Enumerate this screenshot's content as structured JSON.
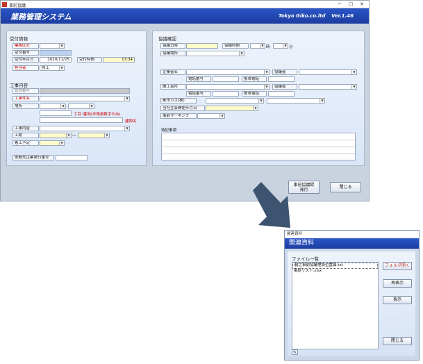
{
  "main": {
    "titlebar": {
      "title": "事前協議",
      "min": "─",
      "max": "□",
      "close": "✕"
    },
    "banner": {
      "system_title": "業務管理システム",
      "company": "Tokyo Giko.co.ltd",
      "version": "Ver.1.46"
    },
    "left": {
      "reception": {
        "section": "受付情報",
        "business_type_label": "業務区分",
        "receipt_no_label": "受付番号",
        "receipt_date_label": "受付年月日",
        "receipt_date_value": "2020/11/25",
        "receipt_time_label": "受付時間",
        "receipt_time_value": "13:34",
        "person_label": "担当者",
        "person_value": "技工"
      },
      "work": {
        "section": "工事内容",
        "management_no_label": "管理番号",
        "work_name_label": "工事件名",
        "location_label": "場所",
        "address_hint": "丁目･番地(半角英数字のみ)",
        "building_label": "建物名",
        "work_content_label": "工事内容",
        "period_label": "工期",
        "tilde": "〜",
        "plan_label": "着工予定"
      },
      "request_no_label": "依頼先企業発行番号"
    },
    "right": {
      "section": "協議確認",
      "meeting_date_label": "協議日時",
      "meeting_time_label": "協議時間",
      "hour_unit": "時",
      "minute_unit": "分",
      "meeting_place_label": "協議場所",
      "company_name_label": "企業者名",
      "phone_label": "電話番号",
      "mobile_label": "携帯電話",
      "negotiator_label": "協議者",
      "contractor_label": "施工会社",
      "city_gas_label": "都市ガス(株)",
      "witness_date_label": "当社立会開始年月日",
      "marking_label": "事前マーキング",
      "notes_label": "特記事項"
    },
    "buttons": {
      "issue": "事前協議録\n発行",
      "close": "閉じる"
    }
  },
  "sub": {
    "titlebar": "関連資料",
    "banner": "関連資料",
    "file_list_label": "ファイル一覧",
    "files": [
      "鶴之事前協議埋設位置図.txt",
      "電話リスト.xlsx"
    ],
    "buttons": {
      "open_folder": "フォルダ開く",
      "refresh": "再表示",
      "show": "表示",
      "close": "閉じる"
    }
  },
  "colors": {
    "banner": "#1c3ca0",
    "required_label": "#d00000",
    "required_field": "#fffbc8",
    "readonly_field": "#b9d2f3",
    "arrow": "#3d5470"
  }
}
